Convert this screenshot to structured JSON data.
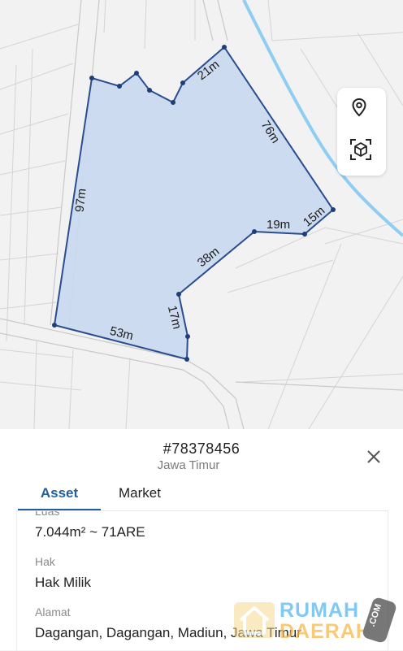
{
  "map": {
    "plot_segments": [
      "21m",
      "76m",
      "15m",
      "19m",
      "38m",
      "17m",
      "53m",
      "97m"
    ],
    "plot_fill": "#c9d9ef",
    "plot_stroke": "#2a4d8f",
    "river_color": "#8fcdf2",
    "controls": {
      "location_icon": "location-pin-icon",
      "ar_icon": "ar-cube-icon"
    }
  },
  "parcel": {
    "id": "#78378456",
    "region": "Jawa Timur"
  },
  "tabs": {
    "asset": "Asset",
    "market": "Market"
  },
  "fields": {
    "luas_label": "Luas",
    "luas_value": "7.044m² ~ 71ARE",
    "hak_label": "Hak",
    "hak_value": "Hak Milik",
    "alamat_label": "Alamat",
    "alamat_value": "Dagangan, Dagangan, Madiun, Jawa Timur"
  },
  "watermark": {
    "word1": "RUMAH",
    "word2": "DAERAH",
    "badge": ".COM"
  }
}
